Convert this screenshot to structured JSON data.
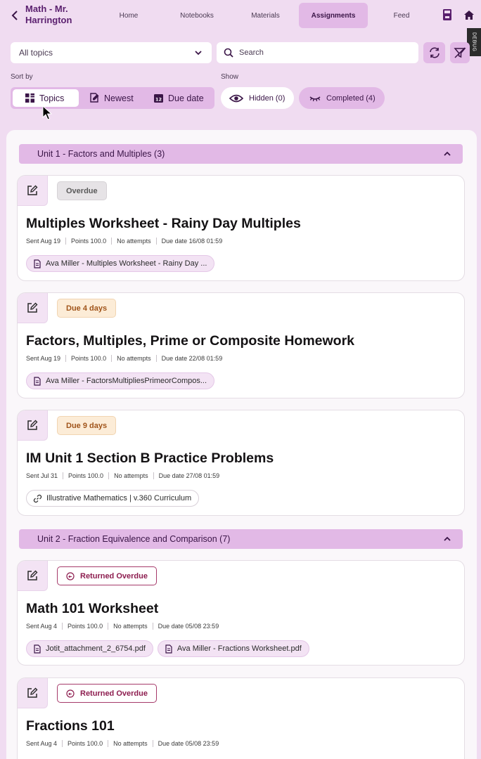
{
  "header": {
    "course_title": "Math - Mr. Harrington",
    "tabs": [
      {
        "label": "Home"
      },
      {
        "label": "Notebooks"
      },
      {
        "label": "Materials"
      },
      {
        "label": "Assignments",
        "active": true
      },
      {
        "label": "Feed"
      }
    ],
    "debug_label": "DEBUG"
  },
  "filters": {
    "topic_value": "All topics",
    "search_placeholder": "Search"
  },
  "sort": {
    "label": "Sort by",
    "options": [
      {
        "label": "Topics",
        "active": true
      },
      {
        "label": "Newest"
      },
      {
        "label": "Due date"
      }
    ]
  },
  "show": {
    "label": "Show",
    "hidden": "Hidden (0)",
    "completed": "Completed (4)"
  },
  "units": [
    {
      "title": "Unit 1 - Factors and Multiples (3)",
      "assignments": [
        {
          "status": "Overdue",
          "title": "Multiples Worksheet - Rainy Day Multiples",
          "sent": "Sent Aug 19",
          "points": "Points 100.0",
          "attempts": "No attempts",
          "due": "Due date 16/08 01:59",
          "attachments": [
            "Ava Miller - Multiples Worksheet - Rainy Day ..."
          ]
        },
        {
          "status": "Due 4 days",
          "title": "Factors, Multiples, Prime or Composite Homework",
          "sent": "Sent Aug 19",
          "points": "Points 100.0",
          "attempts": "No attempts",
          "due": "Due date 22/08 01:59",
          "attachments": [
            "Ava Miller - FactorsMultipliesPrimeorCompos..."
          ]
        },
        {
          "status": "Due 9 days",
          "title": "IM Unit 1 Section B Practice Problems",
          "sent": "Sent Jul 31",
          "points": "Points 100.0",
          "attempts": "No attempts",
          "due": "Due date 27/08 01:59",
          "links": [
            "Illustrative Mathematics | v.360 Curriculum"
          ]
        }
      ]
    },
    {
      "title": "Unit 2 - Fraction Equivalence and Comparison (7)",
      "assignments": [
        {
          "status": "Returned Overdue",
          "title": "Math 101 Worksheet",
          "sent": "Sent Aug 4",
          "points": "Points 100.0",
          "attempts": "No attempts",
          "due": "Due date 05/08 23:59",
          "attachments": [
            "Jotit_attachment_2_6754.pdf",
            "Ava Miller - Fractions Worksheet.pdf"
          ]
        },
        {
          "status": "Returned Overdue",
          "title": "Fractions 101",
          "sent": "Sent Aug 4",
          "points": "Points 100.0",
          "attempts": "No attempts",
          "due": "Due date 05/08 23:59"
        }
      ]
    }
  ],
  "colors": {
    "background": "#f0dcf1",
    "accent": "#e2b9e6",
    "brand_text": "#5a1f6e",
    "overdue": "#5a5a5a",
    "due_soon": "#a0541a",
    "returned_overdue": "#8d1d4f"
  },
  "icons": {
    "back": "chevron-left-icon",
    "notebook": "notebook-icon",
    "home": "home-icon",
    "search": "search-icon",
    "refresh": "refresh-icon",
    "filter": "filter-off-icon",
    "edit": "edit-icon",
    "attachment": "file-icon",
    "link": "link-icon"
  }
}
